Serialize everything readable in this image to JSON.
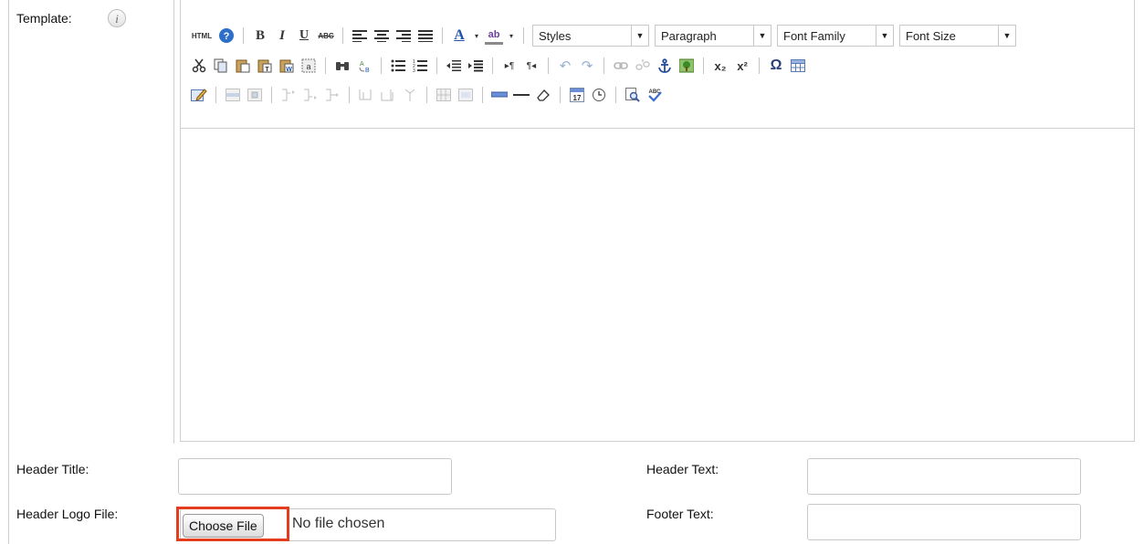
{
  "labels": {
    "template": "Template:",
    "header_title": "Header Title:",
    "header_text": "Header Text:",
    "header_logo_file": "Header Logo File:",
    "footer_text": "Footer Text:"
  },
  "info_icon_glyph": "i",
  "toolbar": {
    "html_label": "HTML",
    "bold": "B",
    "italic": "I",
    "underline": "U",
    "strike": "ABC",
    "font_color": "A",
    "highlight": "ab",
    "subscript": "x₂",
    "superscript": "x²",
    "omega": "Ω",
    "dropdowns": {
      "styles": "Styles",
      "format": "Paragraph",
      "font_family": "Font Family",
      "font_size": "Font Size"
    }
  },
  "header_title": {
    "value": ""
  },
  "header_text": {
    "value": ""
  },
  "footer_text": {
    "value": ""
  },
  "file_input": {
    "button_label": "Choose File",
    "status": "No file chosen"
  },
  "colors": {
    "highlight_border": "#e53b1f",
    "border": "#c8c8c8"
  }
}
